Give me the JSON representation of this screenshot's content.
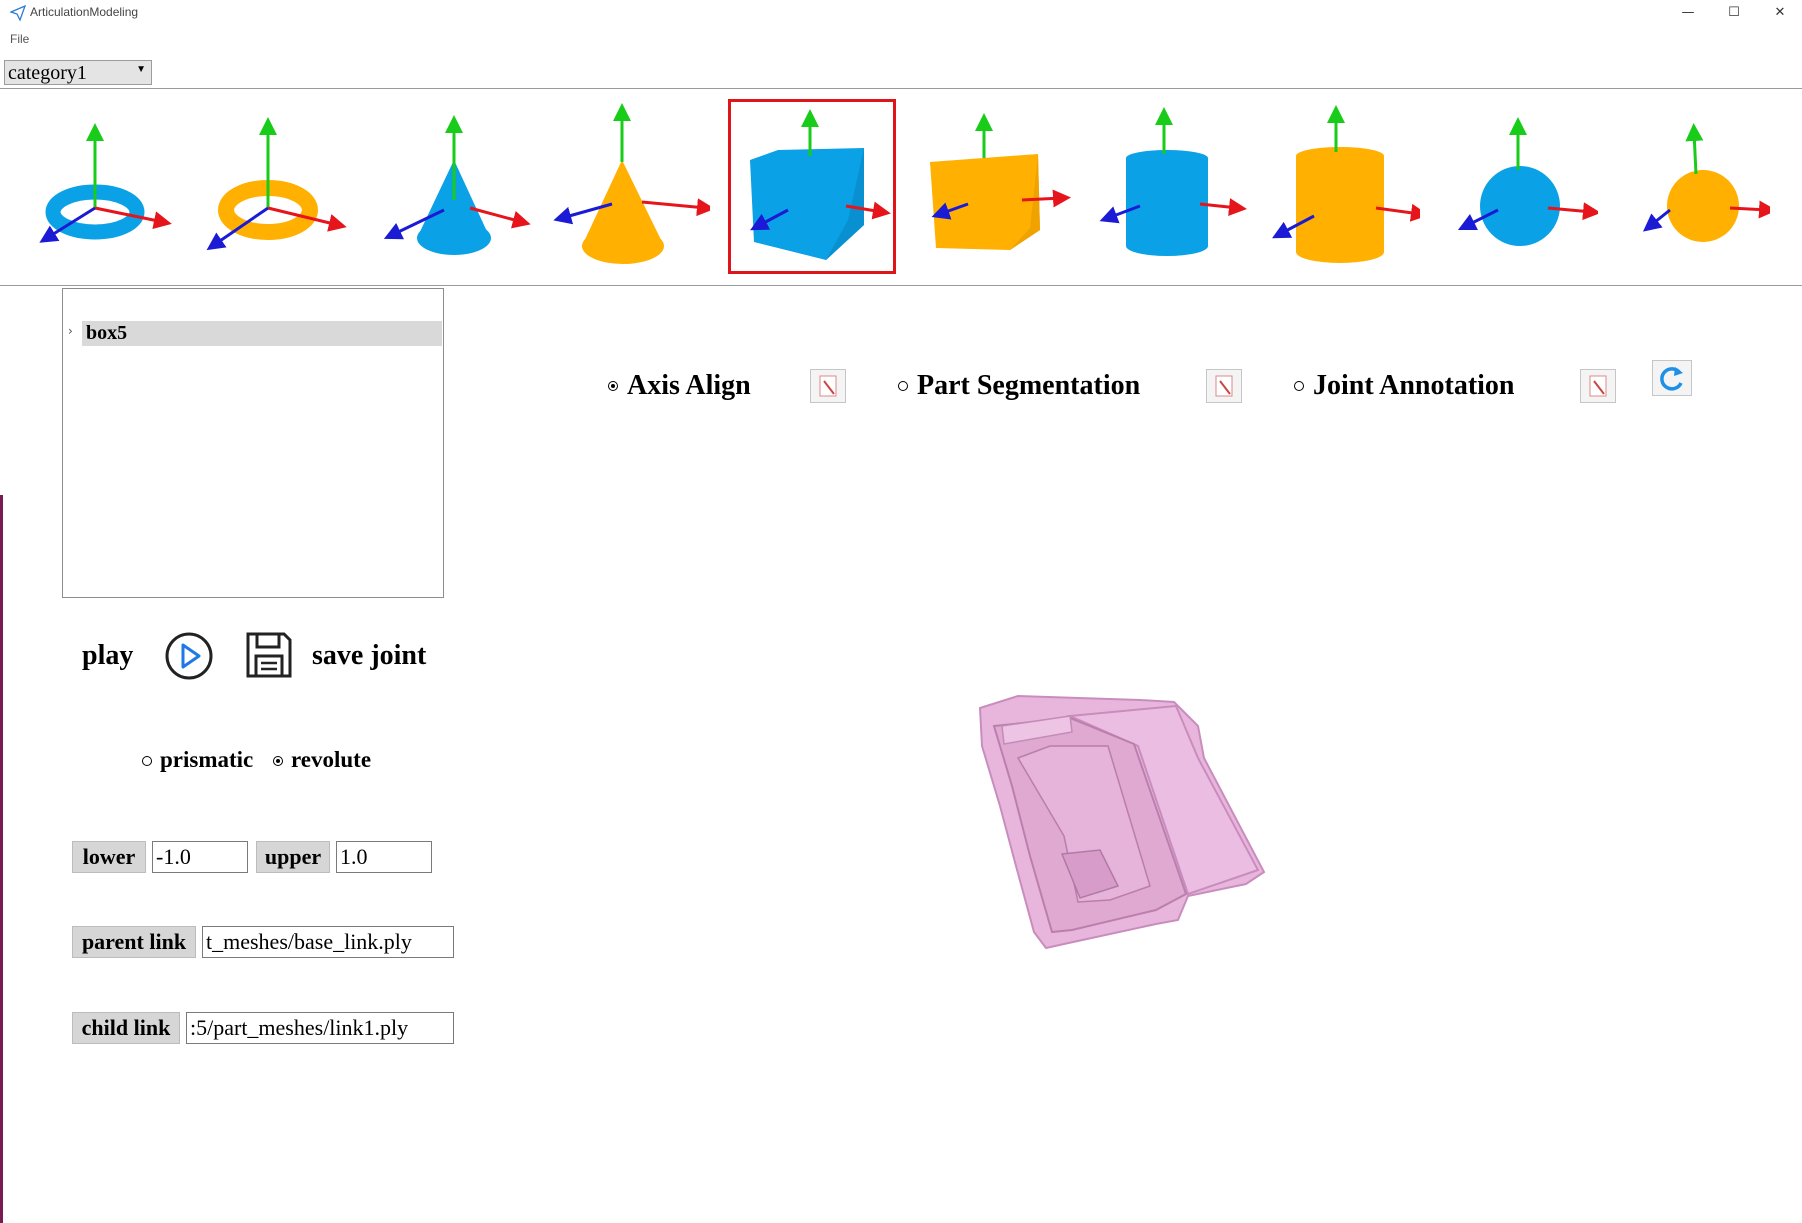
{
  "window": {
    "title": "ArticulationModeling",
    "controls": {
      "minimize": "—",
      "maximize": "☐",
      "close": "✕"
    }
  },
  "menu": {
    "items": [
      "File"
    ]
  },
  "category": {
    "selected": "category1"
  },
  "shapes": [
    {
      "name": "torus",
      "color": "#0aa1e6"
    },
    {
      "name": "torus",
      "color": "#ffb000"
    },
    {
      "name": "cone",
      "color": "#0aa1e6"
    },
    {
      "name": "cone",
      "color": "#ffb000"
    },
    {
      "name": "box",
      "color": "#0aa1e6",
      "selected": true
    },
    {
      "name": "box",
      "color": "#ffb000"
    },
    {
      "name": "cylinder",
      "color": "#0aa1e6"
    },
    {
      "name": "cylinder",
      "color": "#ffb000"
    },
    {
      "name": "sphere",
      "color": "#0aa1e6"
    },
    {
      "name": "sphere",
      "color": "#ffb000"
    }
  ],
  "tree": {
    "items": [
      {
        "label": "box5",
        "expand_icon": "chevron-right-icon"
      }
    ]
  },
  "controls": {
    "play_label": "play",
    "play_icon": "play-circle-icon",
    "save_icon": "floppy-disk-icon",
    "save_label": "save joint"
  },
  "joint_type": {
    "prismatic": "prismatic",
    "revolute": "revolute",
    "selected": "revolute"
  },
  "limits": {
    "lower_label": "lower",
    "lower_value": "-1.0",
    "upper_label": "upper",
    "upper_value": "1.0"
  },
  "links": {
    "parent_label": "parent link",
    "parent_value": "t_meshes/base_link.ply",
    "child_label": "child link",
    "child_value": ":5/part_meshes/link1.ply"
  },
  "modes": {
    "axis_align": "Axis Align",
    "part_segmentation": "Part Segmentation",
    "joint_annotation": "Joint Annotation",
    "selected": "axis_align",
    "refresh_icon": "refresh-icon",
    "edit_icon": "edit-icon"
  },
  "colors": {
    "mesh": "#e8b6dd",
    "selection": "#e0151a",
    "x_axis": "#e6141b",
    "y_axis": "#19cc19",
    "z_axis": "#1b1bd6"
  }
}
